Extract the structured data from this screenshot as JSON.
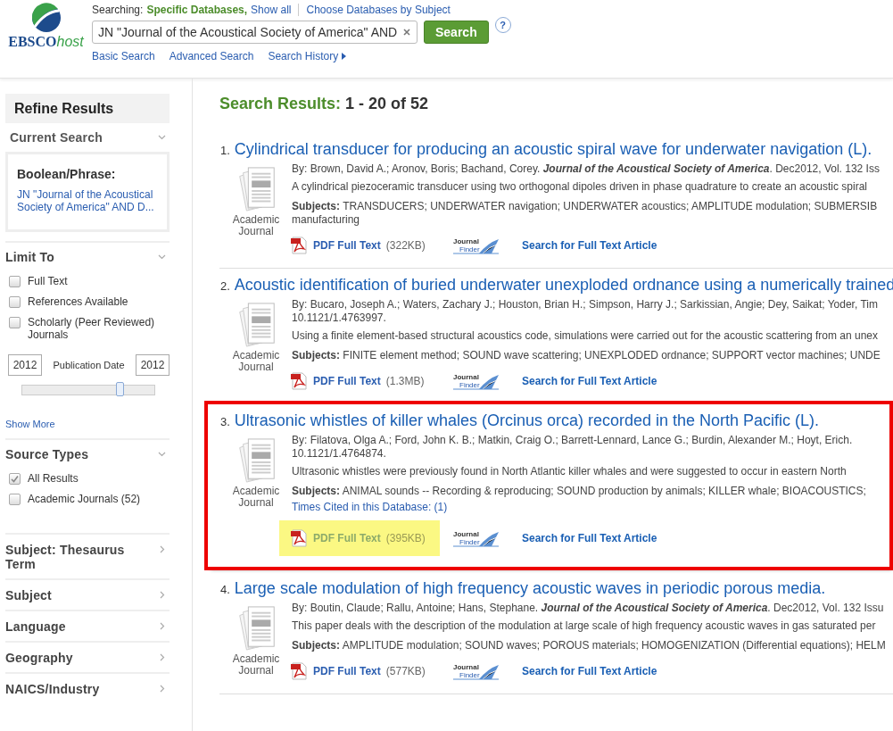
{
  "logo": {
    "brand": "EBSCO",
    "suffix": "host"
  },
  "header": {
    "searching_label": "Searching:",
    "searching_value": "Specific Databases,",
    "show_all": "Show all",
    "choose_databases": "Choose Databases by Subject",
    "query": "JN \"Journal of the Acoustical Society of America\" AND",
    "search_button": "Search",
    "help": "?",
    "links": [
      "Basic Search",
      "Advanced Search",
      "Search History"
    ]
  },
  "sidebar": {
    "title": "Refine Results",
    "current_search": {
      "heading": "Current Search",
      "expanded": true,
      "label": "Boolean/Phrase:",
      "value": "JN \"Journal of the Acoustical Society of America\" AND D..."
    },
    "limit_to": {
      "heading": "Limit To",
      "expanded": true,
      "options": [
        {
          "label": "Full Text",
          "checked": false
        },
        {
          "label": "References Available",
          "checked": false
        },
        {
          "label": "Scholarly (Peer Reviewed) Journals",
          "checked": false
        }
      ],
      "date_from": "2012",
      "date_label": "Publication Date",
      "date_to": "2012",
      "slider": {
        "level": 0.74
      },
      "show_more": "Show More"
    },
    "source_types": {
      "heading": "Source Types",
      "expanded": true,
      "options": [
        {
          "label": "All Results",
          "checked": true
        },
        {
          "label": "Academic Journals (52)",
          "checked": false
        }
      ]
    },
    "facets": [
      {
        "heading": "Subject: Thesaurus Term",
        "expanded": false
      },
      {
        "heading": "Subject",
        "expanded": false
      },
      {
        "heading": "Language",
        "expanded": false
      },
      {
        "heading": "Geography",
        "expanded": false
      },
      {
        "heading": "NAICS/Industry",
        "expanded": false
      }
    ]
  },
  "results_heading": {
    "label": "Search Results:",
    "range": "1 - 20 of 52"
  },
  "results": [
    {
      "number": "1.",
      "title": "Cylindrical transducer for producing an acoustic spiral wave for underwater navigation (L).",
      "type": "Academic Journal",
      "by": [
        "By: Brown, David A.; Aronov, Boris; Bachand, Corey. **Journal of the Acoustical Society of America**. Dec2012, Vol. 132 Iss"
      ],
      "abstract": "A cylindrical piezoceramic transducer using two orthogonal dipoles driven in phase quadrature to create an acoustic spiral",
      "subjects": [
        "**Subjects:** TRANSDUCERS; UNDERWATER navigation; UNDERWATER acoustics; AMPLITUDE modulation; SUBMERSIB",
        "manufacturing"
      ],
      "pdf": "PDF Full Text",
      "pdf_size": "(322KB)",
      "pdf_highlighted": false,
      "finder_logo": [
        "Journal",
        "Finder"
      ],
      "finder": "Search for Full Text Article",
      "highlighted": false
    },
    {
      "number": "2.",
      "title": "Acoustic identification of buried underwater unexploded ordnance using a numerically trained",
      "type": "Academic Journal",
      "by": [
        "By: Bucaro, Joseph A.; Waters, Zachary J.; Houston, Brian H.; Simpson, Harry J.; Sarkissian, Angie; Dey, Saikat; Yoder, Tim",
        "10.1121/1.4763997."
      ],
      "abstract": "Using a finite element-based structural acoustics code, simulations were carried out for the acoustic scattering from an unex",
      "subjects": [
        "**Subjects:** FINITE element method; SOUND wave scattering; UNEXPLODED ordnance; SUPPORT vector machines; UNDE"
      ],
      "pdf": "PDF Full Text",
      "pdf_size": "(1.3MB)",
      "pdf_highlighted": false,
      "finder_logo": [
        "Journal",
        "Finder"
      ],
      "finder": "Search for Full Text Article",
      "highlighted": false
    },
    {
      "number": "3.",
      "title": "Ultrasonic whistles of killer whales (Orcinus orca) recorded in the North Pacific (L).",
      "type": "Academic Journal",
      "by": [
        "By: Filatova, Olga A.; Ford, John K. B.; Matkin, Craig O.; Barrett-Lennard, Lance G.; Burdin, Alexander M.; Hoyt, Erich.",
        "10.1121/1.4764874."
      ],
      "abstract": "Ultrasonic whistles were previously found in North Atlantic killer whales and were suggested to occur in eastern North",
      "subjects": [
        "**Subjects:** ANIMAL sounds -- Recording & reproducing; SOUND production by animals; KILLER whale; BIOACOUSTICS;"
      ],
      "times_cited": "Times Cited in this Database: (1)",
      "pdf": "PDF Full Text",
      "pdf_size": "(395KB)",
      "pdf_highlighted": true,
      "finder_logo": [
        "Journal",
        "Finder"
      ],
      "finder": "Search for Full Text Article",
      "highlighted": true
    },
    {
      "number": "4.",
      "title": "Large scale modulation of high frequency acoustic waves in periodic porous media.",
      "type": "Academic Journal",
      "by": [
        "By: Boutin, Claude; Rallu, Antoine; Hans, Stephane. **Journal of the Acoustical Society of America**. Dec2012, Vol. 132 Issu"
      ],
      "abstract": "This paper deals with the description of the modulation at large scale of high frequency acoustic waves in gas saturated per",
      "subjects": [
        "**Subjects:** AMPLITUDE modulation; SOUND waves; POROUS materials; HOMOGENIZATION (Differential equations); HELM"
      ],
      "pdf": "PDF Full Text",
      "pdf_size": "(577KB)",
      "pdf_highlighted": false,
      "finder_logo": [
        "Journal",
        "Finder"
      ],
      "finder": "Search for Full Text Article",
      "highlighted": false
    }
  ]
}
